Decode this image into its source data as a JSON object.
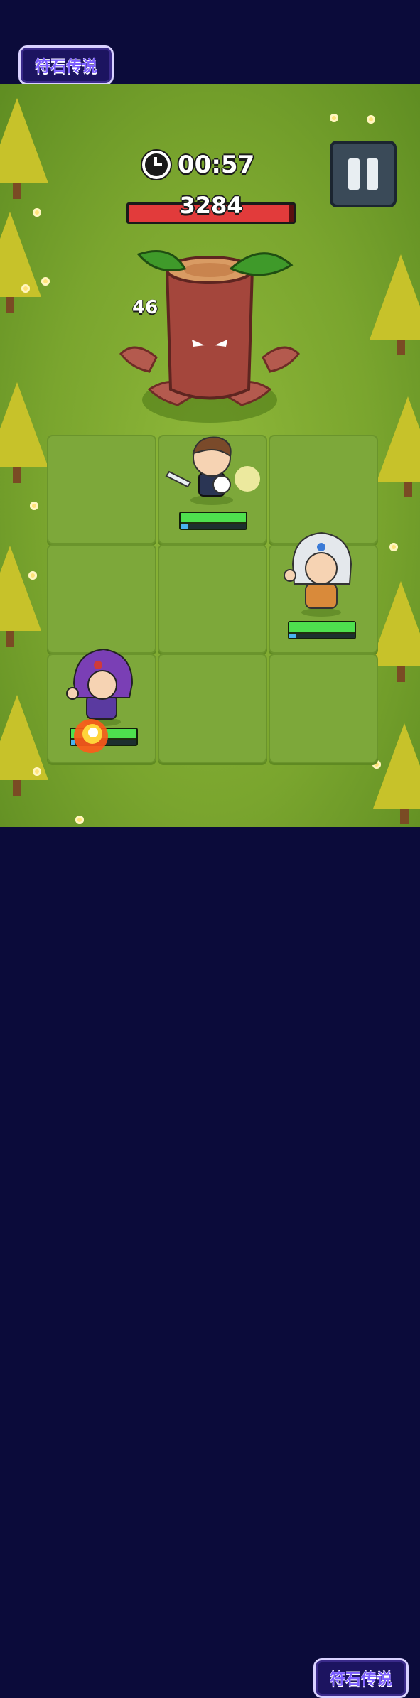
{
  "logo": {
    "text": "符石传说"
  },
  "hud": {
    "timer": "00:57",
    "boss_hp": "3284",
    "boss_hp_fraction": 0.97,
    "damage_popup": "46"
  },
  "heroes": [
    {
      "name": "knight",
      "hp_fraction": 1.0,
      "mp_fraction": 0.12
    },
    {
      "name": "cleric",
      "hp_fraction": 1.0,
      "mp_fraction": 0.1
    },
    {
      "name": "mage",
      "hp_fraction": 1.0,
      "mp_fraction": 0.05
    }
  ],
  "colors": {
    "boss_hp": "#e23b3b",
    "hero_hp": "#4ee04e",
    "hero_mp": "#49b3f0",
    "banner": "#0b0b3a"
  },
  "icons": {
    "clock": "clock-icon",
    "pause": "pause-icon"
  }
}
